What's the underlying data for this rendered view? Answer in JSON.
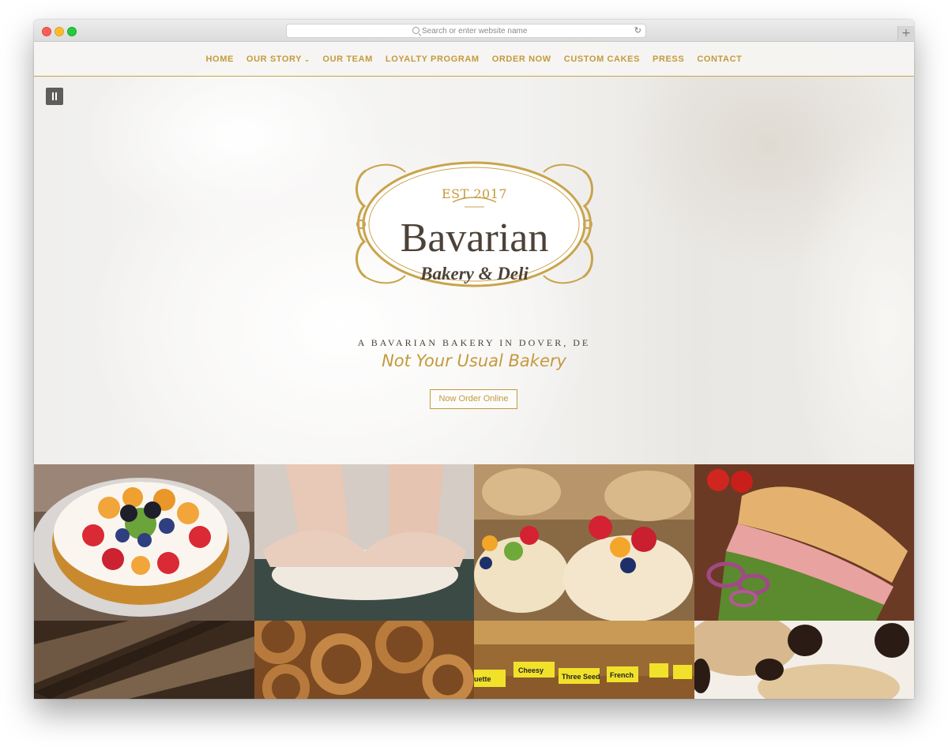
{
  "browser": {
    "search_placeholder": "Search or enter website name",
    "reload_icon": "reload-icon",
    "new_tab_label": "+"
  },
  "nav": {
    "items": [
      {
        "label": "HOME"
      },
      {
        "label": "OUR STORY",
        "has_dropdown": true
      },
      {
        "label": "OUR TEAM"
      },
      {
        "label": "LOYALTY PROGRAM"
      },
      {
        "label": "ORDER NOW"
      },
      {
        "label": "CUSTOM CAKES"
      },
      {
        "label": "PRESS"
      },
      {
        "label": "CONTACT"
      }
    ]
  },
  "hero": {
    "logo": {
      "est": "EST 2017",
      "name": "Bavarian",
      "subtitle": "Bakery & Deli"
    },
    "tagline": "A BAVARIAN BAKERY IN DOVER, DE",
    "slogan": "Not Your Usual Bakery",
    "cta": "Now Order Online"
  },
  "gallery": {
    "tiles": [
      {
        "name": "fruit-tart-image"
      },
      {
        "name": "kneading-dough-image"
      },
      {
        "name": "fruit-pastries-image"
      },
      {
        "name": "sandwich-image"
      },
      {
        "name": "seeded-bread-image"
      },
      {
        "name": "pretzels-image"
      },
      {
        "name": "bread-display-image",
        "labels": [
          "uette",
          "Cheesy",
          "Three Seed",
          "French"
        ]
      },
      {
        "name": "chocolate-cookies-image"
      }
    ]
  },
  "colors": {
    "accent_gold": "#c49a3c",
    "logo_brown": "#4d4237"
  }
}
